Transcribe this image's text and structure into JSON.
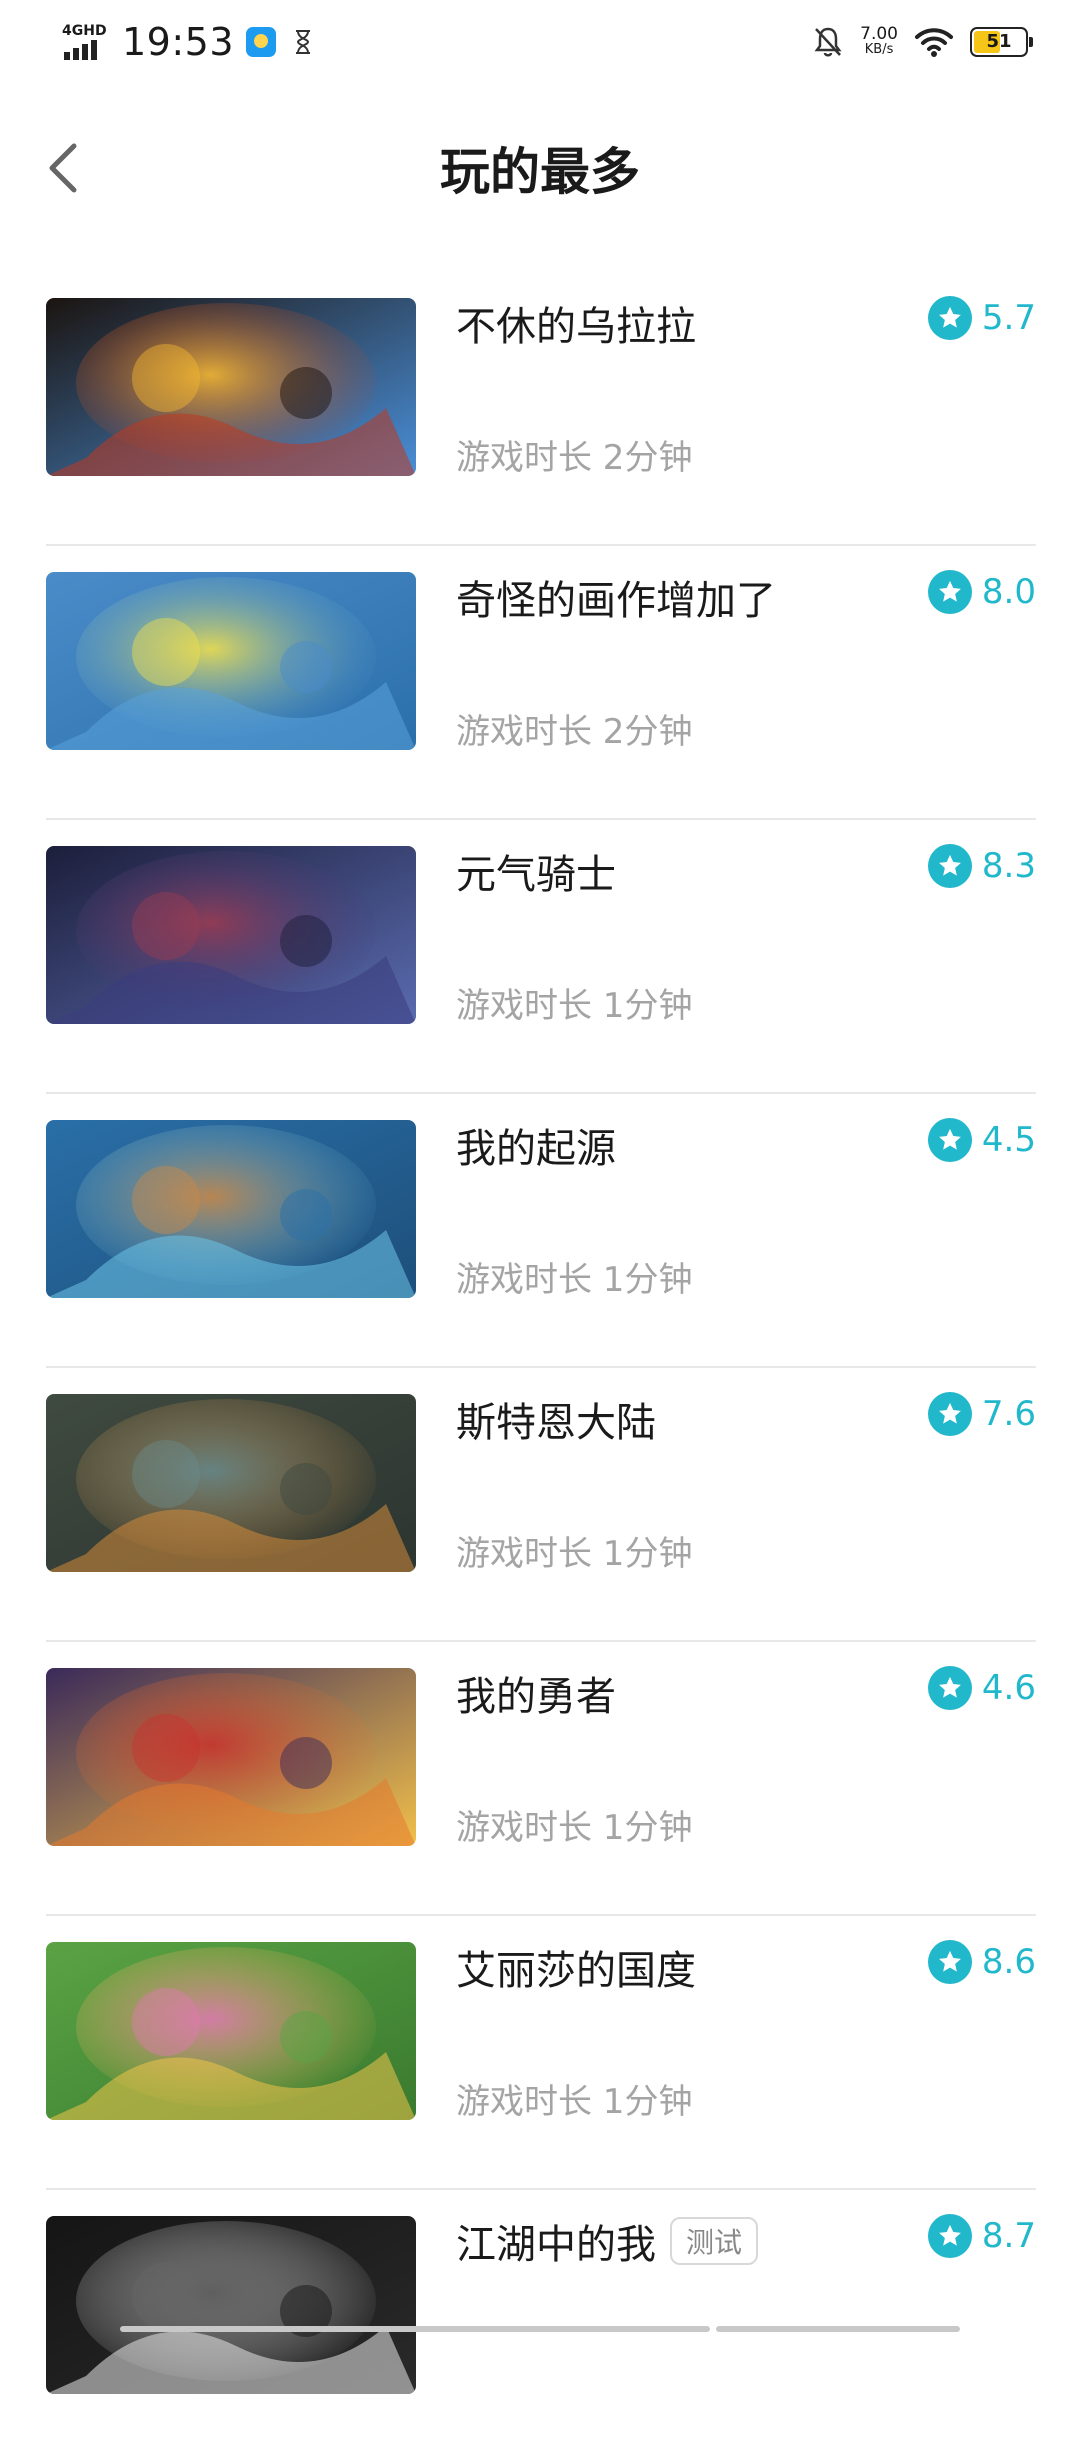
{
  "status_bar": {
    "network": "4GHD",
    "time": "19:53",
    "speed_value": "7.00",
    "speed_unit": "KB/s",
    "battery": "51",
    "battery_level": 0.51,
    "icons": [
      "signal-icon",
      "app-notification-icon",
      "hourglass-icon",
      "bell-muted-icon",
      "wifi-icon",
      "battery-icon"
    ]
  },
  "header": {
    "title": "玩的最多",
    "back_icon": "chevron-left-icon"
  },
  "colors": {
    "accent": "#21b8cc",
    "secondary_text": "#a4a4a4",
    "divider": "#e8e8e8"
  },
  "games": [
    {
      "name": "不休的乌拉拉",
      "rating": "5.7",
      "duration": "游戏时长 2分钟",
      "tag": ""
    },
    {
      "name": "奇怪的画作增加了",
      "rating": "8.0",
      "duration": "游戏时长 2分钟",
      "tag": ""
    },
    {
      "name": "元气骑士",
      "rating": "8.3",
      "duration": "游戏时长 1分钟",
      "tag": ""
    },
    {
      "name": "我的起源",
      "rating": "4.5",
      "duration": "游戏时长 1分钟",
      "tag": ""
    },
    {
      "name": "斯特恩大陆",
      "rating": "7.6",
      "duration": "游戏时长 1分钟",
      "tag": ""
    },
    {
      "name": "我的勇者",
      "rating": "4.6",
      "duration": "游戏时长 1分钟",
      "tag": ""
    },
    {
      "name": "艾丽莎的国度",
      "rating": "8.6",
      "duration": "游戏时长 1分钟",
      "tag": ""
    },
    {
      "name": "江湖中的我",
      "rating": "8.7",
      "duration": "",
      "tag": "测试"
    }
  ]
}
